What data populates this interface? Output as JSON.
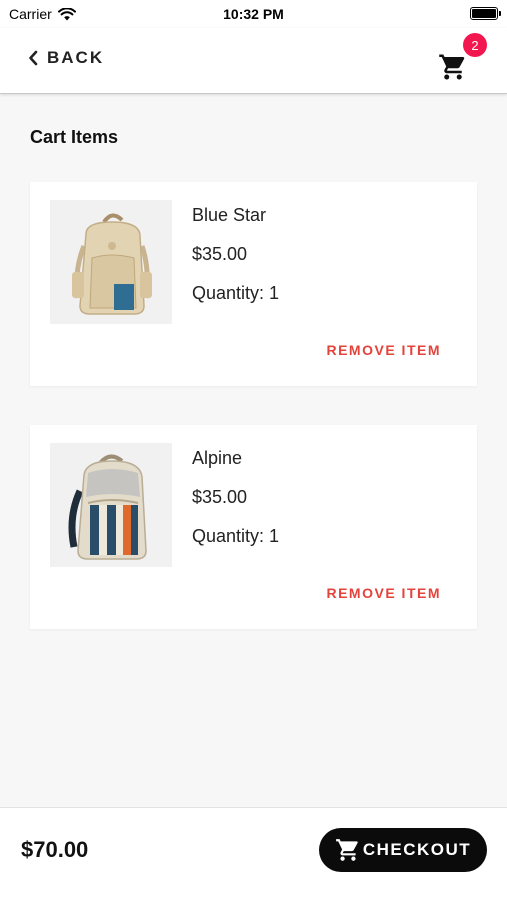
{
  "status_bar": {
    "carrier": "Carrier",
    "time": "10:32 PM"
  },
  "header": {
    "back_label": "BACK",
    "cart_badge_count": "2"
  },
  "page": {
    "title": "Cart Items"
  },
  "cart_items": [
    {
      "name": "Blue Star",
      "price": "$35.00",
      "quantity_text": "Quantity: 1",
      "remove_label": "REMOVE ITEM"
    },
    {
      "name": "Alpine",
      "price": "$35.00",
      "quantity_text": "Quantity: 1",
      "remove_label": "REMOVE ITEM"
    }
  ],
  "footer": {
    "total": "$70.00",
    "checkout_label": "CHECKOUT"
  },
  "colors": {
    "badge": "#f2184f",
    "remove_text": "#e4433b",
    "checkout_bg": "#0b0b0b"
  }
}
